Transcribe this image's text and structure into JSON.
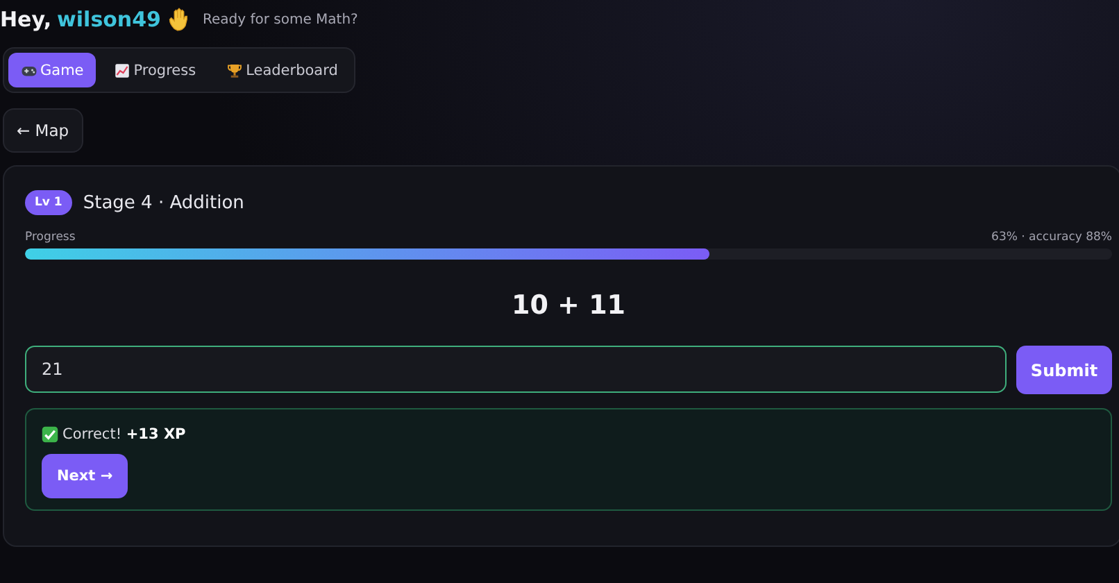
{
  "header": {
    "greeting": "Hey,",
    "username": "wilson49",
    "subtitle": "Ready for some Math?"
  },
  "tabs": [
    {
      "label": "Game",
      "kind": "game",
      "selected": true
    },
    {
      "label": "Progress",
      "kind": "progress",
      "selected": false
    },
    {
      "label": "Leaderboard",
      "kind": "leaderboard",
      "selected": false
    }
  ],
  "back_button": "← Map",
  "stage": {
    "badge": "Lv 1",
    "title": "Stage 4 · Addition"
  },
  "progress": {
    "label": "Progress",
    "stats": "63% · accuracy 88%",
    "level": 0.63
  },
  "question": "10 + 11",
  "answer": {
    "value": "21"
  },
  "submit_button": "Submit",
  "feedback": {
    "kind": "correct",
    "text": "Correct! **+13 XP**",
    "button": "Next →"
  }
}
